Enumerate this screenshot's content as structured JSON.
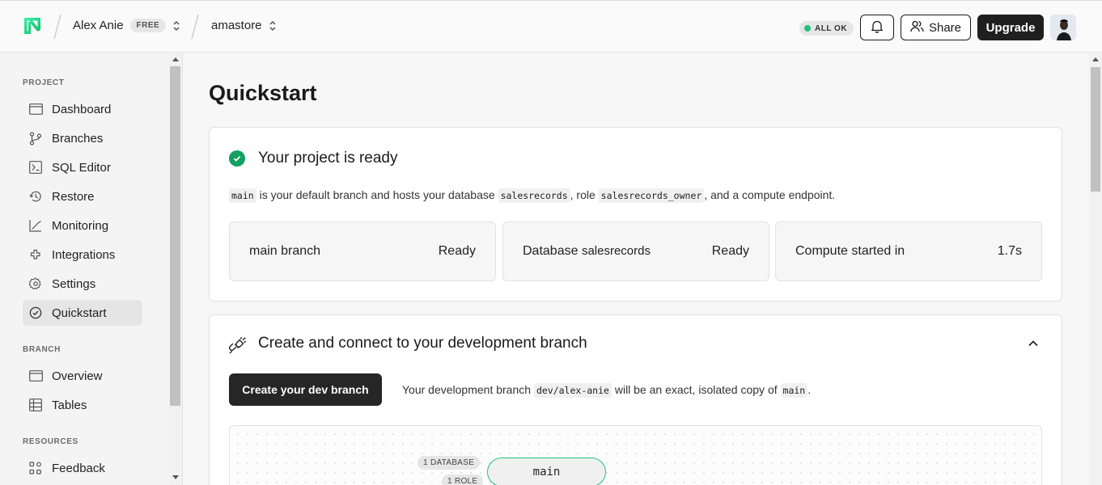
{
  "header": {
    "user_name": "Alex Anie",
    "plan_badge": "FREE",
    "project_name": "amastore",
    "status": "ALL OK",
    "share_label": "Share",
    "upgrade_label": "Upgrade"
  },
  "sidebar": {
    "project_label": "PROJECT",
    "project_items": [
      {
        "label": "Dashboard",
        "icon": "dashboard-icon"
      },
      {
        "label": "Branches",
        "icon": "branches-icon"
      },
      {
        "label": "SQL Editor",
        "icon": "sql-editor-icon"
      },
      {
        "label": "Restore",
        "icon": "restore-icon"
      },
      {
        "label": "Monitoring",
        "icon": "monitoring-icon"
      },
      {
        "label": "Integrations",
        "icon": "integrations-icon"
      },
      {
        "label": "Settings",
        "icon": "gear-icon"
      },
      {
        "label": "Quickstart",
        "icon": "check-circle-icon"
      }
    ],
    "branch_label": "BRANCH",
    "branch_items": [
      {
        "label": "Overview",
        "icon": "overview-icon"
      },
      {
        "label": "Tables",
        "icon": "table-icon"
      }
    ],
    "resources_label": "RESOURCES",
    "resources_items": [
      {
        "label": "Feedback",
        "icon": "feedback-icon"
      }
    ]
  },
  "main": {
    "title": "Quickstart",
    "ready_card": {
      "title": "Your project is ready",
      "desc_branch": "main",
      "desc_text_1": "is your default branch and hosts your database",
      "desc_db": "salesrecords",
      "desc_text_2": ", role",
      "desc_role": "salesrecords_owner",
      "desc_text_3": ", and a compute endpoint.",
      "stats": [
        {
          "label": "main branch",
          "value": "Ready"
        },
        {
          "label_prefix": "Database",
          "label_db": "salesrecords",
          "value": "Ready"
        },
        {
          "label": "Compute started in",
          "value": "1.7s"
        }
      ]
    },
    "dev_card": {
      "title": "Create and connect to your development branch",
      "button_label": "Create your dev branch",
      "desc_text_1": "Your development branch",
      "desc_branch": "dev/alex-anie",
      "desc_text_2": "will be an exact, isolated copy of",
      "desc_main": "main",
      "desc_text_3": ".",
      "graph": {
        "tag_database": "1 DATABASE",
        "tag_role": "1 ROLE",
        "node_label": "main"
      }
    }
  },
  "colors": {
    "accent_green": "#12a160",
    "status_green": "#1fc37c",
    "dark_button": "#262626"
  }
}
